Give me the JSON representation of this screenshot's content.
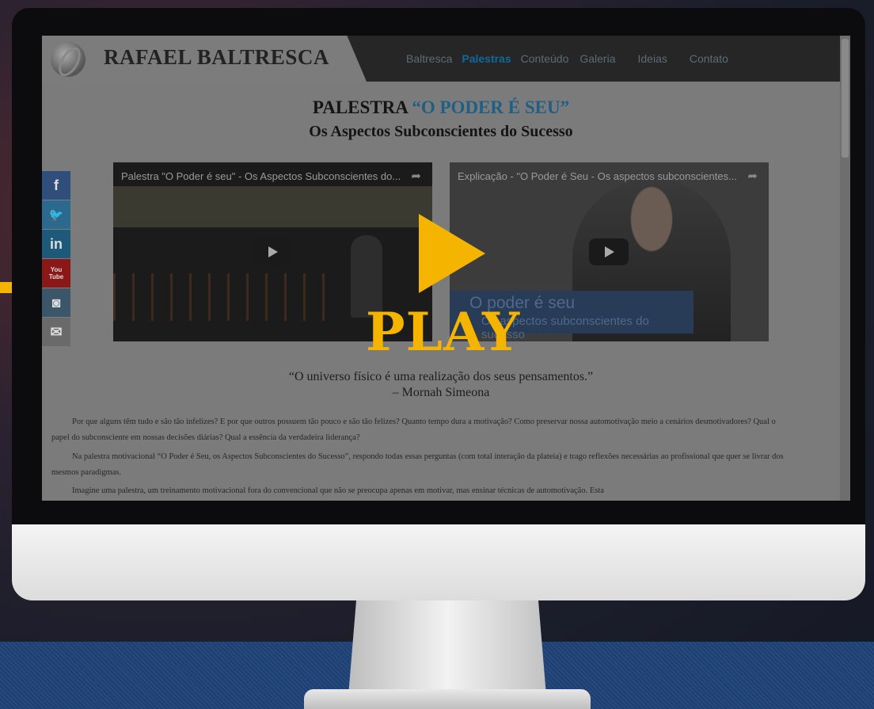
{
  "site": {
    "title": "RAFAEL BALTRESCA",
    "nav": [
      "Baltresca",
      "Palestras",
      "Conteúdo",
      "Galeria",
      "Ideias",
      "Contato"
    ],
    "nav_active": "Palestras"
  },
  "heading": {
    "prefix": "PALESTRA ",
    "quote": "“O PODER É SEU”",
    "subtitle": "Os Aspectos Subconscientes do Sucesso"
  },
  "social": [
    {
      "label": "f",
      "icon": "facebook-icon",
      "color": "#2f4f7a"
    },
    {
      "label": "🐦",
      "icon": "twitter-icon",
      "color": "#2b6a8e"
    },
    {
      "label": "in",
      "icon": "linkedin-icon",
      "color": "#1d5a7a"
    },
    {
      "label": "You\nTube",
      "icon": "youtube-icon",
      "color": "#8c1717"
    },
    {
      "label": "◙",
      "icon": "instagram-icon",
      "color": "#3b5669"
    },
    {
      "label": "✉",
      "icon": "mail-icon",
      "color": "#6a6a6a"
    }
  ],
  "videos": [
    {
      "title": "Palestra \"O Poder é seu\" - Os Aspectos Subconscientes do...",
      "share": "➦"
    },
    {
      "title": "Explicação - \"O Poder é Seu - Os aspectos subconscientes...",
      "share": "➦",
      "banner_title": "O poder é seu",
      "banner_sub": "Os aspectos subconscientes do sucesso"
    }
  ],
  "overlay": {
    "play_text": "PLAY"
  },
  "citation": {
    "quote": "“O universo físico é uma realização dos seus pensamentos.”",
    "author": "– Mornah Simeona"
  },
  "paragraphs": [
    "Por que alguns têm tudo e são tão infelizes? E por que outros possuem tão pouco e são tão felizes? Quanto tempo dura a motivação? Como preservar nossa automotivação meio a cenários desmotivadores? Qual o papel do subconsciente em nossas decisões diárias? Qual a essência da verdadeira liderança?",
    "Na palestra motivacional “O Poder é Seu, os Aspectos Subconscientes do Sucesso”, respondo todas essas perguntas (com total interação da plateia) e trago reflexões necessárias ao profissional que quer se livrar dos mesmos paradigmas.",
    "Imagine uma palestra, um treinamento motivacional fora do convencional que não se preocupa apenas em motivar, mas ensinar técnicas de automotivação. Esta"
  ],
  "colors": {
    "accent": "#f4b400",
    "link": "#0f6a9b"
  }
}
